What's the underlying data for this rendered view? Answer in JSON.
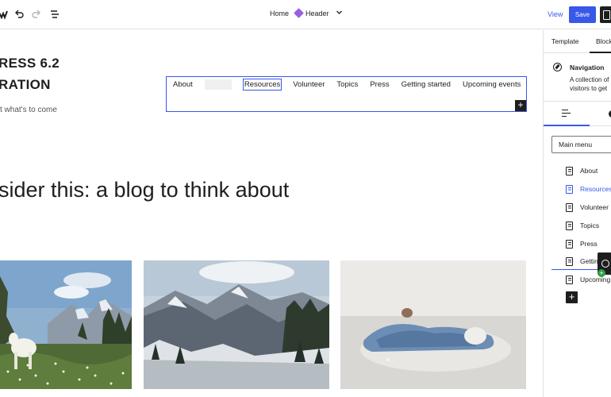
{
  "toolbar": {
    "breadcrumb_home": "Home",
    "breadcrumb_current": "Header",
    "view_label": "View",
    "save_label": "Save",
    "accent_color": "#3858e9"
  },
  "canvas": {
    "site_title": "RESS 6.2\nRATION",
    "tagline": "t what's to come",
    "headline": "sider this: a blog to think about",
    "nav_items": [
      "About",
      "",
      "Resources",
      "Volunteer",
      "Topics",
      "Press",
      "Getting started",
      "Upcoming events"
    ],
    "images": [
      "mountain-goat-meadow",
      "snowy-mountains",
      "person-on-floor-under-blanket"
    ]
  },
  "sidebar": {
    "tabs": [
      "Template",
      "Block"
    ],
    "block_name": "Navigation",
    "block_description": "A collection of\nvisitors to get",
    "menu_select": "Main menu",
    "menu_items": [
      "About",
      "Resources",
      "Volunteer",
      "Topics",
      "Press",
      "Getting",
      "Upcoming"
    ],
    "selected_item": "Resources"
  }
}
